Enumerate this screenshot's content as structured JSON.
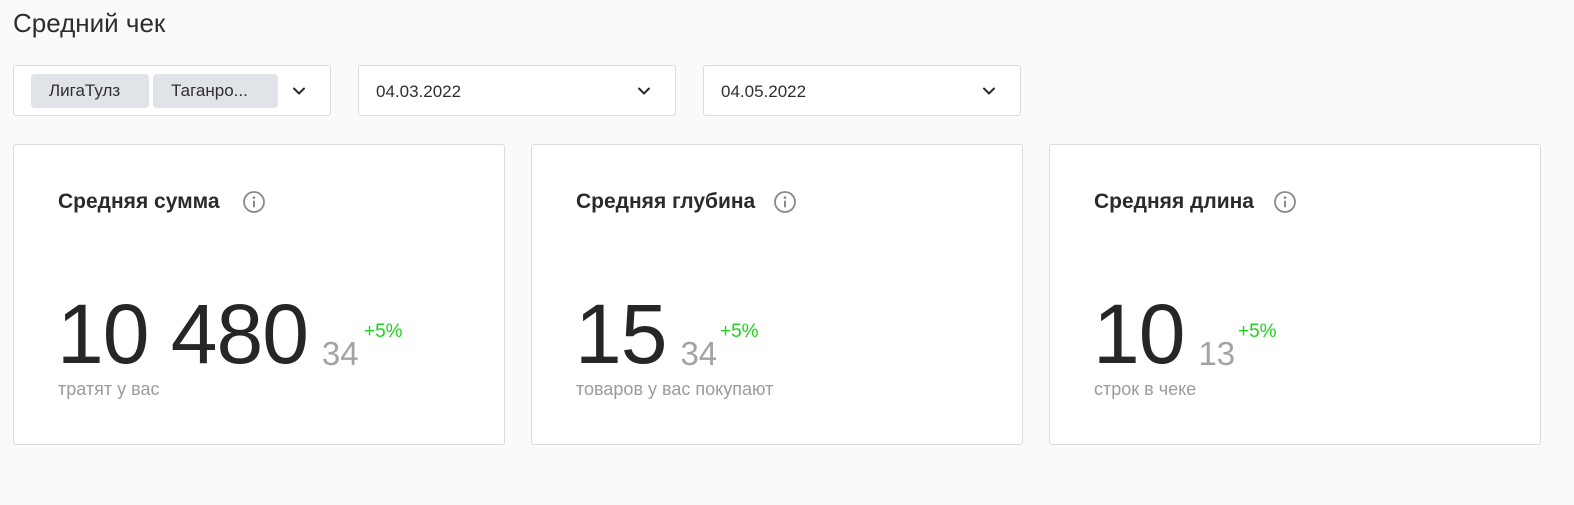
{
  "page": {
    "title": "Средний чек"
  },
  "filters": {
    "stores": {
      "chips": [
        "ЛигаТулз",
        "Таганро..."
      ],
      "chevron_icon": "chevron-down-icon"
    },
    "date_from": {
      "value": "04.03.2022",
      "chevron_icon": "chevron-down-icon"
    },
    "date_to": {
      "value": "04.05.2022",
      "chevron_icon": "chevron-down-icon"
    }
  },
  "cards": [
    {
      "title": "Средняя сумма",
      "info_icon": "info-icon",
      "value": "10 480",
      "compare_value": "34",
      "delta": "+5%",
      "caption": "тратят у вас"
    },
    {
      "title": "Средняя глубина",
      "info_icon": "info-icon",
      "value": "15",
      "compare_value": "34",
      "delta": "+5%",
      "caption": "товаров у вас покупают"
    },
    {
      "title": "Средняя длина",
      "info_icon": "info-icon",
      "value": "10",
      "compare_value": "13",
      "delta": "+5%",
      "caption": "строк в чеке"
    }
  ],
  "colors": {
    "background": "#fafafa",
    "card_background": "#ffffff",
    "border": "#dcdcdc",
    "chip_background": "#e0e3e7",
    "positive_delta": "#1ad31a",
    "muted_text": "#9b9b9b"
  }
}
